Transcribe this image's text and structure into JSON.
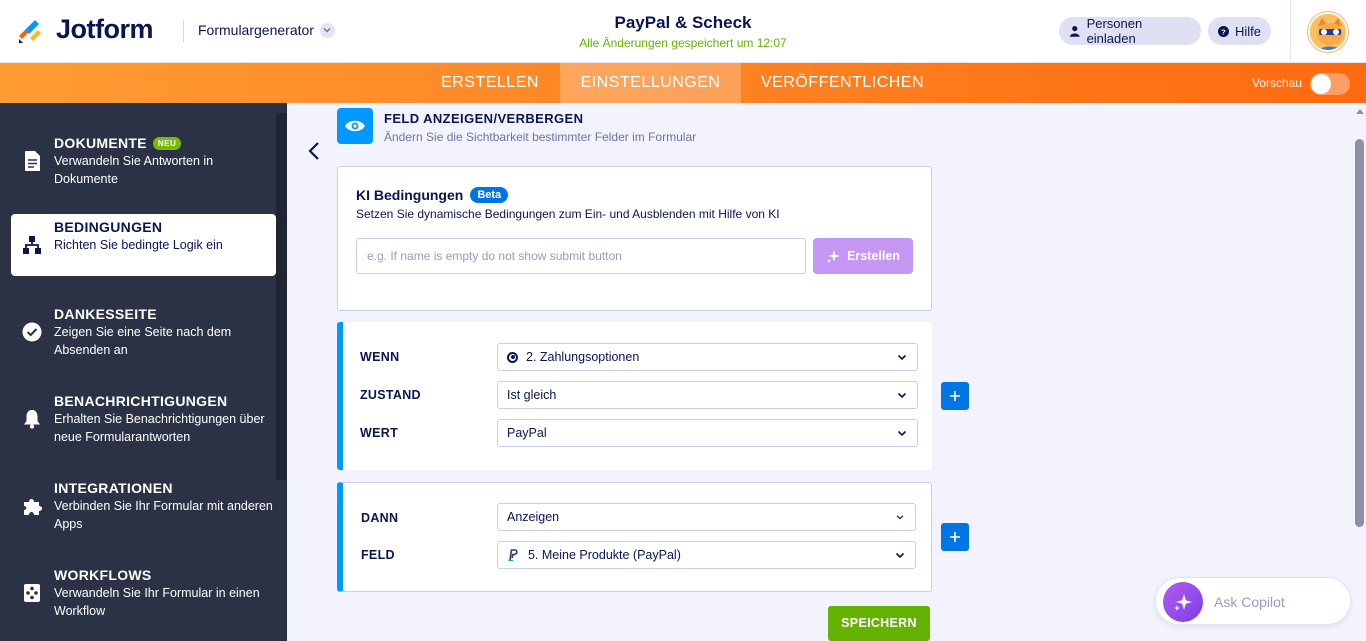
{
  "header": {
    "brand": "Jotform",
    "form_generator": "Formulargenerator",
    "form_title": "PayPal & Scheck",
    "saved_status": "Alle Änderungen gespeichert um 12:07",
    "invite_label": "Personen einladen",
    "help_label": "Hilfe"
  },
  "nav": {
    "tabs": [
      {
        "label": "ERSTELLEN",
        "active": false
      },
      {
        "label": "EINSTELLUNGEN",
        "active": true
      },
      {
        "label": "VERÖFFENTLICHEN",
        "active": false
      }
    ],
    "preview_label": "Vorschau",
    "accent_color": "#ff7f1f"
  },
  "sidebar": {
    "items": [
      {
        "title": "DOKUMENTE",
        "badge": "NEU",
        "desc": "Verwandeln Sie Antworten in Dokumente",
        "icon": "document-icon",
        "active": false
      },
      {
        "title": "BEDINGUNGEN",
        "desc": "Richten Sie bedingte Logik ein",
        "icon": "logic-tree-icon",
        "active": true
      },
      {
        "title": "DANKESSEITE",
        "desc": "Zeigen Sie eine Seite nach dem Absenden an",
        "icon": "check-circle-icon",
        "active": false
      },
      {
        "title": "BENACHRICHTIGUNGEN",
        "desc": "Erhalten Sie Benachrichtigungen über neue Formularantworten",
        "icon": "bell-icon",
        "active": false
      },
      {
        "title": "INTEGRATIONEN",
        "desc": "Verbinden Sie Ihr Formular mit anderen Apps",
        "icon": "puzzle-icon",
        "active": false
      },
      {
        "title": "WORKFLOWS",
        "desc": "Verwandeln Sie Ihr Formular in einen Workflow",
        "icon": "workflow-icon",
        "active": false
      }
    ]
  },
  "section": {
    "title": "FELD ANZEIGEN/VERBERGEN",
    "subtitle": "Ändern Sie die Sichtbarkeit bestimmter Felder im Formular"
  },
  "ai": {
    "title": "KI Bedingungen",
    "badge": "Beta",
    "subtitle": "Setzen Sie dynamische Bedingungen zum Ein- und Ausblenden mit Hilfe von KI",
    "placeholder": "e.g. If name is empty do not show submit button",
    "button_label": "Erstellen"
  },
  "condition": {
    "if_label": "WENN",
    "if_value": "2. Zahlungsoptionen",
    "state_label": "ZUSTAND",
    "state_value": "Ist gleich",
    "value_label": "WERT",
    "value_value": "PayPal"
  },
  "action": {
    "then_label": "DANN",
    "then_value": "Anzeigen",
    "field_label": "FELD",
    "field_value": "5. Meine Produkte (PayPal)"
  },
  "save_label": "SPEICHERN",
  "copilot_label": "Ask Copilot"
}
